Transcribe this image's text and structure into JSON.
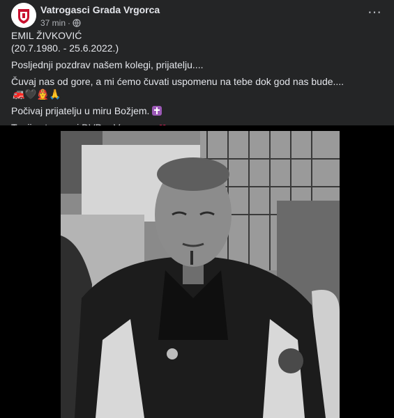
{
  "post": {
    "page_name": "Vatrogasci Grada Vrgorca",
    "time": "37 min",
    "audience_icon": "globe-icon",
    "lines": {
      "name": "EMIL ŽIVKOVIĆ",
      "dates": "(20.7.1980. - 25.6.2022.)",
      "farewell": "Posljednji pozdrav našem kolegi, prijatelju....",
      "memory": "Čuvaj nas od gore, a mi ćemo čuvati uspomenu na tebe dok god nas bude....",
      "memory_emoji": "🚒🖤👨‍🚒🙏",
      "rest": "Počivaj prijatelju u miru Božjem.",
      "signature": "Tvoji vatrogasci DVD-a Vrgorac...",
      "heart_emoji": "❤"
    }
  },
  "colors": {
    "background": "#18191a",
    "card": "#242526",
    "text": "#e4e6eb",
    "secondary_text": "#b0b3b8"
  }
}
